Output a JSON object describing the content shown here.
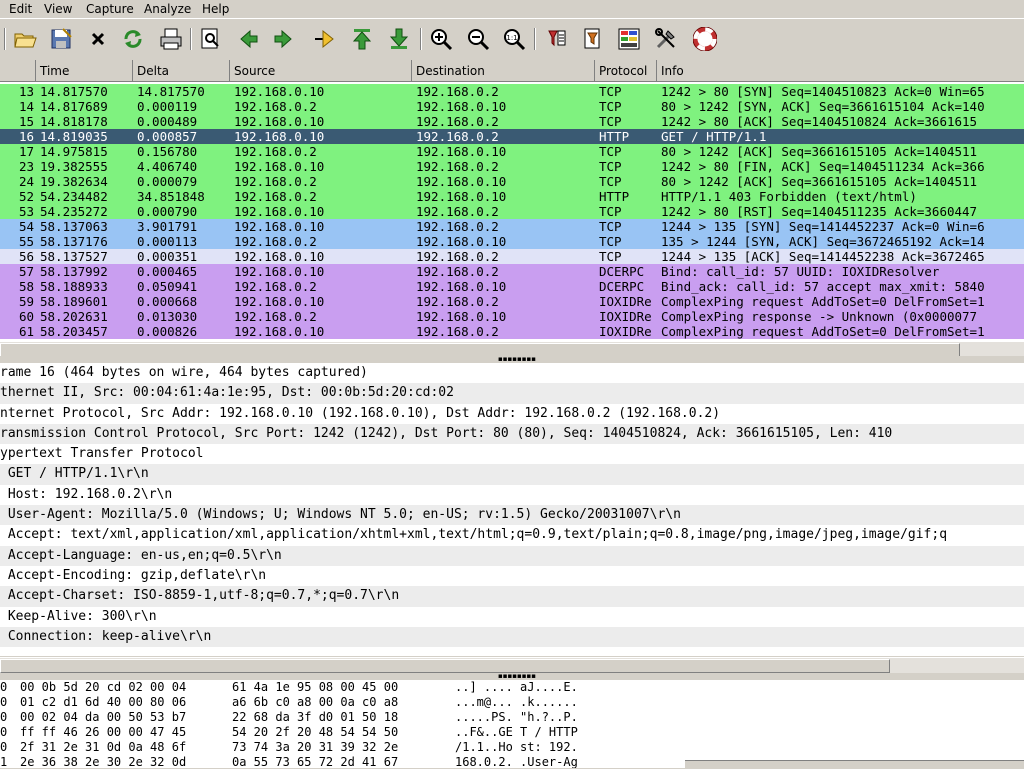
{
  "menu": [
    "Edit",
    "View",
    "Capture",
    "Analyze",
    "Help"
  ],
  "toolbar": [
    "open-icon",
    "save-icon",
    "close-icon",
    "reload-icon",
    "print-icon",
    "find-icon",
    "back-icon",
    "forward-icon",
    "goto-icon",
    "first-icon",
    "last-icon",
    "zoom-in-icon",
    "zoom-out-icon",
    "zoom-normal-icon",
    "capture-filter-icon",
    "display-filter-icon",
    "coloring-icon",
    "preferences-icon",
    "help-icon"
  ],
  "columns": {
    "time": "Time",
    "delta": "Delta",
    "source": "Source",
    "destination": "Destination",
    "protocol": "Protocol",
    "info": "Info"
  },
  "colors": {
    "green": "#7ff27f",
    "selected": "#3a5a73",
    "blue": "#99c4f4",
    "lightblue": "#e0e3f7",
    "purple": "#c99ef0"
  },
  "packets": [
    {
      "no": "13",
      "time": "14.817570",
      "delta": "14.817570",
      "src": "192.168.0.10",
      "dst": "192.168.0.2",
      "proto": "TCP",
      "info": "1242 > 80 [SYN] Seq=1404510823 Ack=0 Win=65",
      "color": "green"
    },
    {
      "no": "14",
      "time": "14.817689",
      "delta": "0.000119",
      "src": "192.168.0.2",
      "dst": "192.168.0.10",
      "proto": "TCP",
      "info": "80 > 1242 [SYN, ACK] Seq=3661615104 Ack=140",
      "color": "green"
    },
    {
      "no": "15",
      "time": "14.818178",
      "delta": "0.000489",
      "src": "192.168.0.10",
      "dst": "192.168.0.2",
      "proto": "TCP",
      "info": "1242 > 80 [ACK] Seq=1404510824 Ack=3661615",
      "color": "green"
    },
    {
      "no": "16",
      "time": "14.819035",
      "delta": "0.000857",
      "src": "192.168.0.10",
      "dst": "192.168.0.2",
      "proto": "HTTP",
      "info": "GET / HTTP/1.1",
      "color": "selected"
    },
    {
      "no": "17",
      "time": "14.975815",
      "delta": "0.156780",
      "src": "192.168.0.2",
      "dst": "192.168.0.10",
      "proto": "TCP",
      "info": "80 > 1242 [ACK] Seq=3661615105 Ack=1404511",
      "color": "green"
    },
    {
      "no": "23",
      "time": "19.382555",
      "delta": "4.406740",
      "src": "192.168.0.10",
      "dst": "192.168.0.2",
      "proto": "TCP",
      "info": "1242 > 80 [FIN, ACK] Seq=1404511234 Ack=366",
      "color": "green"
    },
    {
      "no": "24",
      "time": "19.382634",
      "delta": "0.000079",
      "src": "192.168.0.2",
      "dst": "192.168.0.10",
      "proto": "TCP",
      "info": "80 > 1242 [ACK] Seq=3661615105 Ack=1404511",
      "color": "green"
    },
    {
      "no": "52",
      "time": "54.234482",
      "delta": "34.851848",
      "src": "192.168.0.2",
      "dst": "192.168.0.10",
      "proto": "HTTP",
      "info": "HTTP/1.1 403 Forbidden (text/html)",
      "color": "green"
    },
    {
      "no": "53",
      "time": "54.235272",
      "delta": "0.000790",
      "src": "192.168.0.10",
      "dst": "192.168.0.2",
      "proto": "TCP",
      "info": "1242 > 80 [RST] Seq=1404511235 Ack=3660447",
      "color": "green"
    },
    {
      "no": "54",
      "time": "58.137063",
      "delta": "3.901791",
      "src": "192.168.0.10",
      "dst": "192.168.0.2",
      "proto": "TCP",
      "info": "1244 > 135 [SYN] Seq=1414452237 Ack=0 Win=6",
      "color": "blue"
    },
    {
      "no": "55",
      "time": "58.137176",
      "delta": "0.000113",
      "src": "192.168.0.2",
      "dst": "192.168.0.10",
      "proto": "TCP",
      "info": "135 > 1244 [SYN, ACK] Seq=3672465192 Ack=14",
      "color": "blue"
    },
    {
      "no": "56",
      "time": "58.137527",
      "delta": "0.000351",
      "src": "192.168.0.10",
      "dst": "192.168.0.2",
      "proto": "TCP",
      "info": "1244 > 135 [ACK] Seq=1414452238 Ack=3672465",
      "color": "lightblue"
    },
    {
      "no": "57",
      "time": "58.137992",
      "delta": "0.000465",
      "src": "192.168.0.10",
      "dst": "192.168.0.2",
      "proto": "DCERPC",
      "info": "Bind: call_id: 57 UUID: IOXIDResolver",
      "color": "purple"
    },
    {
      "no": "58",
      "time": "58.188933",
      "delta": "0.050941",
      "src": "192.168.0.2",
      "dst": "192.168.0.10",
      "proto": "DCERPC",
      "info": "Bind_ack: call_id: 57 accept max_xmit: 5840",
      "color": "purple"
    },
    {
      "no": "59",
      "time": "58.189601",
      "delta": "0.000668",
      "src": "192.168.0.10",
      "dst": "192.168.0.2",
      "proto": "IOXIDRe",
      "info": "ComplexPing request AddToSet=0 DelFromSet=1",
      "color": "purple"
    },
    {
      "no": "60",
      "time": "58.202631",
      "delta": "0.013030",
      "src": "192.168.0.2",
      "dst": "192.168.0.10",
      "proto": "IOXIDRe",
      "info": "ComplexPing response -> Unknown (0x0000077",
      "color": "purple"
    },
    {
      "no": "61",
      "time": "58.203457",
      "delta": "0.000826",
      "src": "192.168.0.10",
      "dst": "192.168.0.2",
      "proto": "IOXIDRe",
      "info": "ComplexPing request AddToSet=0 DelFromSet=1",
      "color": "purple"
    }
  ],
  "details": [
    "rame 16 (464 bytes on wire, 464 bytes captured)",
    "thernet II, Src: 00:04:61:4a:1e:95, Dst: 00:0b:5d:20:cd:02",
    "nternet Protocol, Src Addr: 192.168.0.10 (192.168.0.10), Dst Addr: 192.168.0.2 (192.168.0.2)",
    "ransmission Control Protocol, Src Port: 1242 (1242), Dst Port: 80 (80), Seq: 1404510824, Ack: 3661615105, Len: 410",
    "ypertext Transfer Protocol",
    " GET / HTTP/1.1\\r\\n",
    " Host: 192.168.0.2\\r\\n",
    " User-Agent: Mozilla/5.0 (Windows; U; Windows NT 5.0; en-US; rv:1.5) Gecko/20031007\\r\\n",
    " Accept: text/xml,application/xml,application/xhtml+xml,text/html;q=0.9,text/plain;q=0.8,image/png,image/jpeg,image/gif;q",
    " Accept-Language: en-us,en;q=0.5\\r\\n",
    " Accept-Encoding: gzip,deflate\\r\\n",
    " Accept-Charset: ISO-8859-1,utf-8;q=0.7,*;q=0.7\\r\\n",
    " Keep-Alive: 300\\r\\n",
    " Connection: keep-alive\\r\\n"
  ],
  "bytes": [
    {
      "offset": "0",
      "hex1": "00 0b 5d 20 cd 02 00 04",
      "hex2": "61 4a 1e 95 08 00 45 00",
      "ascii": "..] .... aJ....E."
    },
    {
      "offset": "0",
      "hex1": "01 c2 d1 6d 40 00 80 06",
      "hex2": "a6 6b c0 a8 00 0a c0 a8",
      "ascii": "...m@... .k......"
    },
    {
      "offset": "0",
      "hex1": "00 02 04 da 00 50 53 b7",
      "hex2": "22 68 da 3f d0 01 50 18",
      "ascii": ".....PS. \"h.?..P."
    },
    {
      "offset": "0",
      "hex1": "ff ff 46 26 00 00 47 45",
      "hex2": "54 20 2f 20 48 54 54 50",
      "ascii": "..F&..GE T / HTTP"
    },
    {
      "offset": "0",
      "hex1": "2f 31 2e 31 0d 0a 48 6f",
      "hex2": "73 74 3a 20 31 39 32 2e",
      "ascii": "/1.1..Ho st: 192."
    },
    {
      "offset": "1",
      "hex1": "2e 36 38 2e 30 2e 32 0d",
      "hex2": "0a 55 73 65 72 2d 41 67",
      "ascii": "168.0.2. .User-Ag"
    }
  ]
}
